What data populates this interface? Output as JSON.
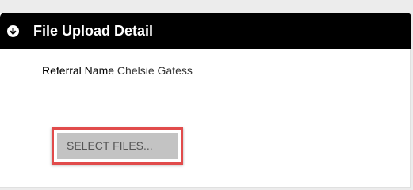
{
  "panel": {
    "title": "File Upload Detail",
    "collapse_icon": "circle-arrow-down-icon"
  },
  "referral": {
    "label": "Referral Name",
    "value": "Chelsie Gatess"
  },
  "upload": {
    "select_files_label": "SELECT FILES..."
  },
  "colors": {
    "header_bg": "#000000",
    "header_text": "#ffffff",
    "button_bg": "#c3c3c3",
    "button_text": "#555555",
    "highlight": "#e14b4b"
  }
}
